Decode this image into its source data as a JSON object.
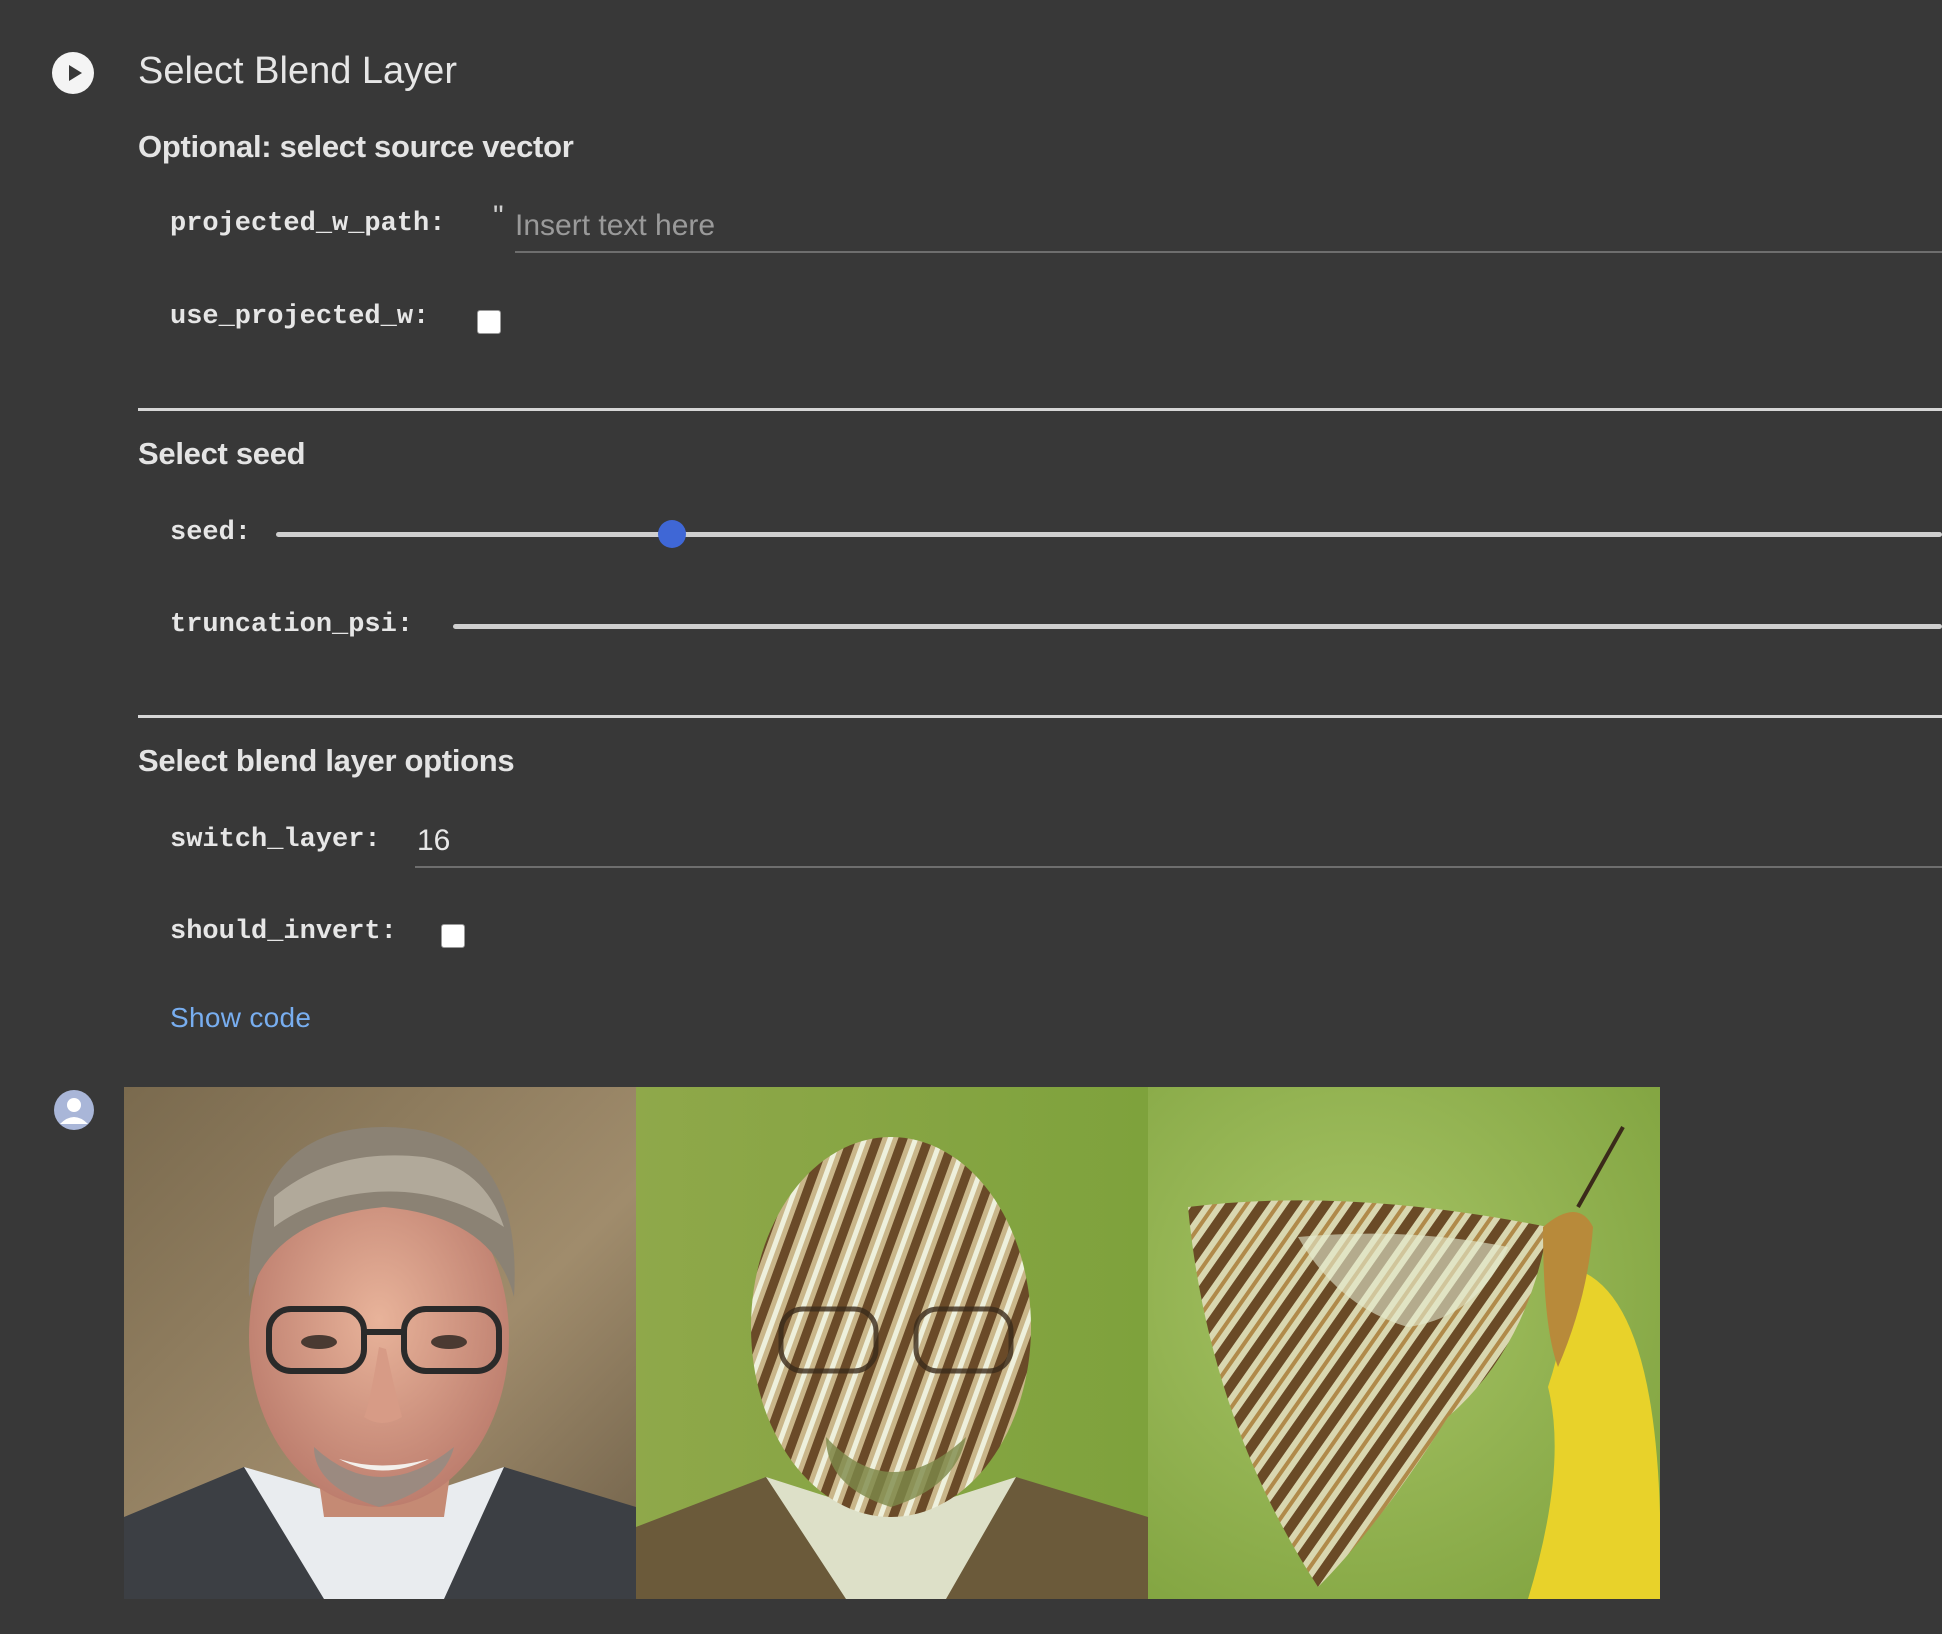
{
  "cell": {
    "title": "Select Blend Layer"
  },
  "sections": {
    "source": {
      "heading": "Optional: select source vector",
      "projected_w_path": {
        "label": "projected_w_path:",
        "quote": "\"",
        "value": "",
        "placeholder": "Insert text here"
      },
      "use_projected_w": {
        "label": "use_projected_w:",
        "checked": false
      }
    },
    "seed": {
      "heading": "Select seed",
      "seed": {
        "label": "seed:",
        "fraction": 0.18
      },
      "truncation_psi": {
        "label": "truncation_psi:"
      }
    },
    "blend": {
      "heading": "Select blend layer options",
      "switch_layer": {
        "label": "switch_layer:",
        "value": "16"
      },
      "should_invert": {
        "label": "should_invert:",
        "checked": false
      }
    }
  },
  "show_code": "Show code",
  "icons": {
    "run": "play-icon",
    "output": "avatar-icon"
  },
  "colors": {
    "background": "#383838",
    "accent": "#3f67d6",
    "link": "#78aef0"
  },
  "output": {
    "panels": [
      "face-photo",
      "blended-face-butterfly",
      "butterfly-photo"
    ]
  }
}
